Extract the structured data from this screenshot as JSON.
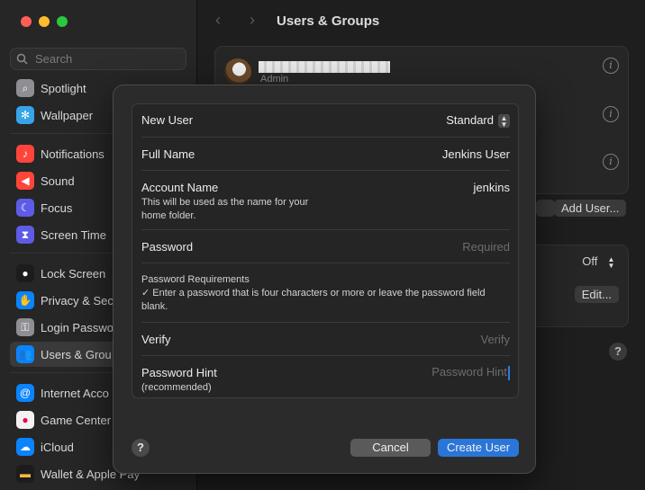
{
  "sidebar": {
    "search_placeholder": "Search",
    "items": [
      {
        "label": "Spotlight",
        "icon": "magnifier-icon",
        "color": "#8e8e93"
      },
      {
        "label": "Wallpaper",
        "icon": "snowflake-icon",
        "color": "#38a4e8"
      },
      {
        "label": "Notifications",
        "icon": "bell-icon",
        "color": "#ff453a"
      },
      {
        "label": "Sound",
        "icon": "speaker-icon",
        "color": "#ff453a"
      },
      {
        "label": "Focus",
        "icon": "moon-icon",
        "color": "#5e5ce6"
      },
      {
        "label": "Screen Time",
        "icon": "hourglass-icon",
        "color": "#5e5ce6"
      },
      {
        "label": "Lock Screen",
        "icon": "lock-icon",
        "color": "#1c1c1e"
      },
      {
        "label": "Privacy & Sec",
        "icon": "hand-icon",
        "color": "#0a84ff"
      },
      {
        "label": "Login Passwo",
        "icon": "key-icon",
        "color": "#8e8e93"
      },
      {
        "label": "Users & Grou",
        "icon": "users-icon",
        "color": "#0a84ff"
      },
      {
        "label": "Internet Acco",
        "icon": "at-icon",
        "color": "#0a84ff"
      },
      {
        "label": "Game Center",
        "icon": "game-center-icon",
        "color": "#ffffff"
      },
      {
        "label": "iCloud",
        "icon": "cloud-icon",
        "color": "#0a84ff"
      },
      {
        "label": "Wallet & Apple Pay",
        "icon": "wallet-icon",
        "color": "#1c1c1e"
      }
    ]
  },
  "main": {
    "title": "Users & Groups",
    "user_role": "Admin",
    "add_user_label": "Add User...",
    "automatic_login_value": "Off",
    "edit_label": "Edit..."
  },
  "modal": {
    "new_user_label": "New User",
    "new_user_value": "Standard",
    "full_name_label": "Full Name",
    "full_name_value": "Jenkins User",
    "account_name_label": "Account Name",
    "account_name_note": "This will be used as the name for your home folder.",
    "account_name_value": "jenkins",
    "password_label": "Password",
    "password_placeholder": "Required",
    "requirements_title": "Password Requirements",
    "requirements_text": "✓ Enter a password that is four characters or more or leave the password field blank.",
    "verify_label": "Verify",
    "verify_placeholder": "Verify",
    "hint_label": "Password Hint",
    "hint_note": "(recommended)",
    "hint_placeholder": "Password Hint",
    "cancel_label": "Cancel",
    "create_label": "Create User",
    "help_glyph": "?"
  },
  "colors": {
    "accent": "#2a75d8",
    "window_bg": "#1e1e1e",
    "modal_bg": "#2b2b2b"
  }
}
